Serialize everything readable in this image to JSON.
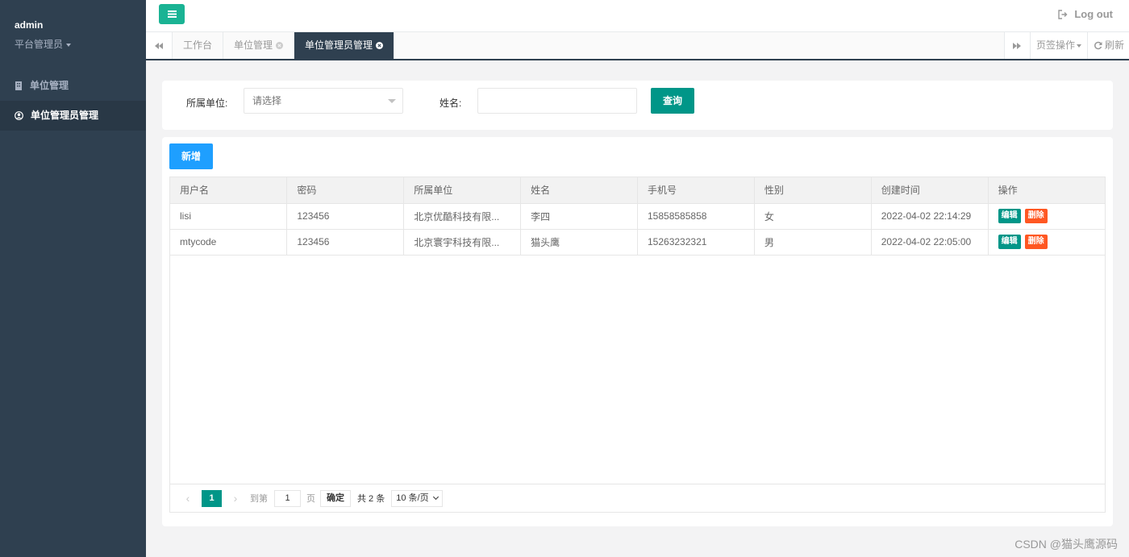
{
  "user": {
    "name": "admin",
    "role": "平台管理员"
  },
  "sidebar": {
    "items": [
      {
        "label": "单位管理",
        "icon": "building-icon",
        "active": false
      },
      {
        "label": "单位管理员管理",
        "icon": "user-circle-icon",
        "active": true
      }
    ]
  },
  "header": {
    "logout_label": "Log out"
  },
  "tabs": {
    "items": [
      {
        "label": "工作台",
        "closable": false,
        "active": false
      },
      {
        "label": "单位管理",
        "closable": true,
        "active": false
      },
      {
        "label": "单位管理员管理",
        "closable": true,
        "active": true
      }
    ],
    "tab_ops_label": "页签操作",
    "refresh_label": "刷新"
  },
  "search": {
    "unit_label": "所属单位:",
    "unit_placeholder": "请选择",
    "name_label": "姓名:",
    "name_value": "",
    "query_label": "查询"
  },
  "toolbar": {
    "add_label": "新增"
  },
  "table": {
    "columns": [
      "用户名",
      "密码",
      "所属单位",
      "姓名",
      "手机号",
      "性别",
      "创建时间",
      "操作"
    ],
    "rows": [
      [
        "lisi",
        "123456",
        "北京优酷科技有限...",
        "李四",
        "15858585858",
        "女",
        "2022-04-02 22:14:29"
      ],
      [
        "mtycode",
        "123456",
        "北京寰宇科技有限...",
        "猫头鹰",
        "15263232321",
        "男",
        "2022-04-02 22:05:00"
      ]
    ],
    "edit_label": "编辑",
    "delete_label": "删除"
  },
  "pager": {
    "current_page": "1",
    "goto_label": "到第",
    "goto_value": "1",
    "page_unit": "页",
    "confirm_label": "确定",
    "total_label": "共 2 条",
    "limit_label": "10 条/页"
  },
  "watermark": "CSDN @猫头鹰源码",
  "colors": {
    "sidebar_bg": "#2f4050",
    "primary_green": "#1ab394",
    "teal": "#009688",
    "blue": "#1e9fff",
    "danger": "#ff5722"
  }
}
